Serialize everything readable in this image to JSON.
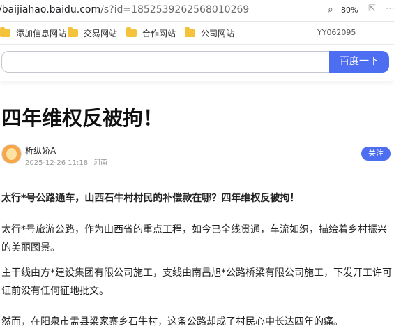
{
  "browser": {
    "url_host": "/baijiahao.baidu.com",
    "url_path": "/s?id=1852539262568010269",
    "zoom": "80%",
    "zoom_icon": "magnifier-icon",
    "share_icon": "share-icon",
    "more_icon": "more-icon"
  },
  "bookmarks": {
    "items": [
      "添加信息网站",
      "交易网站",
      "合作网站",
      "公司网站"
    ],
    "code": "YY062095",
    "folder_color": "#f5c33b"
  },
  "search": {
    "value": "",
    "button_label": "百度一下",
    "accent": "#4e6ef2"
  },
  "article": {
    "title": "四年维权反被拘！",
    "author": "析纵娇A",
    "date": "2025-12-26 11:18",
    "location": "河南",
    "follow_label": "关注",
    "paragraphs": [
      "太行*号公路通车，山西石牛村村民的补偿款在哪？四年维权反被拘！",
      "太行*号旅游公路，作为山西省的重点工程，如今已全线贯通，车流如织，描绘着乡村振兴的美丽图景。",
      "主干线由方*建设集团有限公司施工，支线由南昌旭*公路桥梁有限公司施工，下发开工许可证前没有任何征地批文。",
      "然而，在阳泉市盂县梁家寨乡石牛村，这条公路却成了村民心中长达四年的痛。"
    ]
  }
}
